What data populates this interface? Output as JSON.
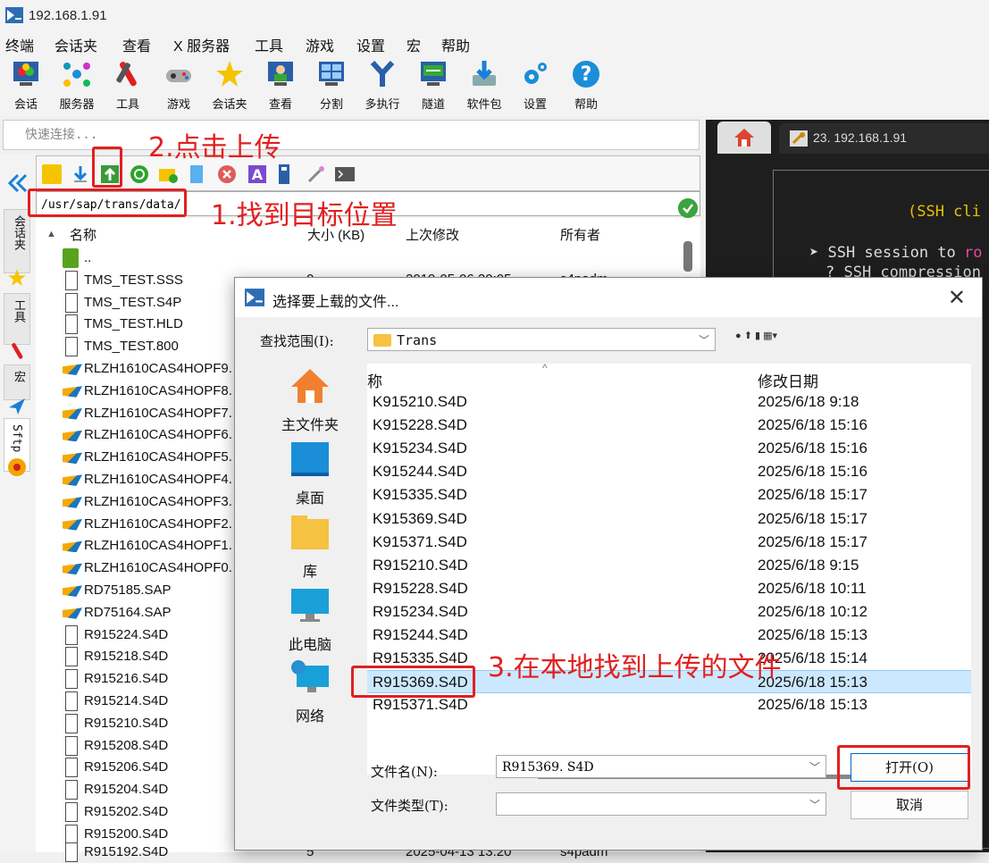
{
  "window": {
    "title": "192.168.1.91"
  },
  "menu": [
    "终端",
    "会话夹",
    "查看",
    "X 服务器",
    "工具",
    "游戏",
    "设置",
    "宏",
    "帮助"
  ],
  "toolbar": [
    "会话",
    "服务器",
    "工具",
    "游戏",
    "会话夹",
    "查看",
    "分割",
    "多执行",
    "隧道",
    "软件包",
    "设置",
    "帮助"
  ],
  "quick_connect": {
    "placeholder": "快速连接..."
  },
  "session_tab": {
    "label": "23. 192.168.1.91"
  },
  "terminal": {
    "line1": "(SSH cli",
    "line2a": "➤ SSH session to ",
    "line2b": "ro",
    "line3": "? SSH compression"
  },
  "side_tabs": [
    "会话夹",
    "工具",
    "宏",
    "Sftp"
  ],
  "sftp": {
    "path": "/usr/sap/trans/data/",
    "columns": {
      "name": "名称",
      "size": "大小 (KB)",
      "modified": "上次修改",
      "owner": "所有者"
    },
    "partial_row": {
      "size": "0",
      "date": "2019-05-06 20:05",
      "owner": "s4padm"
    },
    "last_row": {
      "name": "R915192.S4D",
      "size": "5",
      "date": "2025-04-13 13:20",
      "owner": "s4padm"
    },
    "files": [
      {
        "name": "..",
        "type": "up"
      },
      {
        "name": "TMS_TEST.SSS",
        "type": "doc"
      },
      {
        "name": "TMS_TEST.S4P",
        "type": "doc"
      },
      {
        "name": "TMS_TEST.HLD",
        "type": "doc"
      },
      {
        "name": "TMS_TEST.800",
        "type": "doc"
      },
      {
        "name": "RLZH1610CAS4HOPF9.",
        "type": "sap"
      },
      {
        "name": "RLZH1610CAS4HOPF8.",
        "type": "sap"
      },
      {
        "name": "RLZH1610CAS4HOPF7.",
        "type": "sap"
      },
      {
        "name": "RLZH1610CAS4HOPF6.",
        "type": "sap"
      },
      {
        "name": "RLZH1610CAS4HOPF5.",
        "type": "sap"
      },
      {
        "name": "RLZH1610CAS4HOPF4.",
        "type": "sap"
      },
      {
        "name": "RLZH1610CAS4HOPF3.",
        "type": "sap"
      },
      {
        "name": "RLZH1610CAS4HOPF2.",
        "type": "sap"
      },
      {
        "name": "RLZH1610CAS4HOPF1.",
        "type": "sap"
      },
      {
        "name": "RLZH1610CAS4HOPF0.",
        "type": "sap"
      },
      {
        "name": "RD75185.SAP",
        "type": "sap"
      },
      {
        "name": "RD75164.SAP",
        "type": "sap"
      },
      {
        "name": "R915224.S4D",
        "type": "doc"
      },
      {
        "name": "R915218.S4D",
        "type": "doc"
      },
      {
        "name": "R915216.S4D",
        "type": "doc"
      },
      {
        "name": "R915214.S4D",
        "type": "doc"
      },
      {
        "name": "R915210.S4D",
        "type": "doc"
      },
      {
        "name": "R915208.S4D",
        "type": "doc"
      },
      {
        "name": "R915206.S4D",
        "type": "doc"
      },
      {
        "name": "R915204.S4D",
        "type": "doc"
      },
      {
        "name": "R915202.S4D",
        "type": "doc"
      },
      {
        "name": "R915200.S4D",
        "type": "doc"
      }
    ]
  },
  "dialog": {
    "title": "选择要上载的文件...",
    "close": "✕",
    "look_in_label": "查找范围(I):",
    "look_in_value": "Trans",
    "col_name": "称",
    "col_date": "修改日期",
    "places": [
      "主文件夹",
      "桌面",
      "库",
      "此电脑",
      "网络"
    ],
    "files": [
      {
        "name": "K915210.S4D",
        "date": "2025/6/18 9:18"
      },
      {
        "name": "K915228.S4D",
        "date": "2025/6/18 15:16"
      },
      {
        "name": "K915234.S4D",
        "date": "2025/6/18 15:16"
      },
      {
        "name": "K915244.S4D",
        "date": "2025/6/18 15:16"
      },
      {
        "name": "K915335.S4D",
        "date": "2025/6/18 15:17"
      },
      {
        "name": "K915369.S4D",
        "date": "2025/6/18 15:17"
      },
      {
        "name": "K915371.S4D",
        "date": "2025/6/18 15:17"
      },
      {
        "name": "R915210.S4D",
        "date": "2025/6/18 9:15"
      },
      {
        "name": "R915228.S4D",
        "date": "2025/6/18 10:11"
      },
      {
        "name": "R915234.S4D",
        "date": "2025/6/18 10:12"
      },
      {
        "name": "R915244.S4D",
        "date": "2025/6/18 15:13"
      },
      {
        "name": "R915335.S4D",
        "date": "2025/6/18 15:14"
      },
      {
        "name": "R915369.S4D",
        "date": "2025/6/18 15:13",
        "selected": true
      },
      {
        "name": "R915371.S4D",
        "date": "2025/6/18 15:13"
      }
    ],
    "filename_label": "文件名(N):",
    "filename_value": "R915369. S4D",
    "filetype_label": "文件类型(T):",
    "open_button": "打开(O)",
    "cancel_button": "取消"
  },
  "annotations": {
    "step1": "1.找到目标位置",
    "step2": "2.点击上传",
    "step3": "3.在本地找到上传的文件"
  },
  "colors": {
    "annotation": "#e02020",
    "selection": "#cce8ff",
    "terminal_bg": "#1e1e1e",
    "terminal_text": "#e5c100"
  }
}
